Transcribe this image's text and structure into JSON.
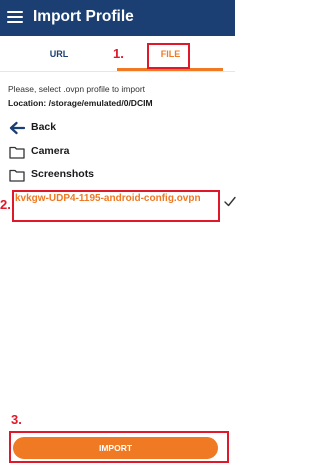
{
  "app_bar": {
    "title": "Import Profile",
    "background": "#1b3f73",
    "menu_icon": "hamburger-menu-icon"
  },
  "tabs": [
    {
      "label": "URL",
      "selected": false
    },
    {
      "label": "FILE",
      "selected": true
    }
  ],
  "accent_color": "#ef7a23",
  "instruction": "Please, select .ovpn profile to import",
  "location_label": "Location: /storage/emulated/0/DCIM",
  "file_list": {
    "back": {
      "label": "Back",
      "icon": "arrow-left-icon"
    },
    "folders": [
      {
        "label": "Camera",
        "icon": "folder-icon"
      },
      {
        "label": "Screenshots",
        "icon": "folder-icon"
      }
    ],
    "files": [
      {
        "label": "kvkgw-UDP4-1195-android-config.ovpn",
        "selected": true,
        "icon": "checkmark-icon"
      }
    ]
  },
  "import_button": {
    "label": "IMPORT"
  },
  "annotations": {
    "step1": "1.",
    "step2": "2.",
    "step3": "3.",
    "color": "#e0182a"
  }
}
